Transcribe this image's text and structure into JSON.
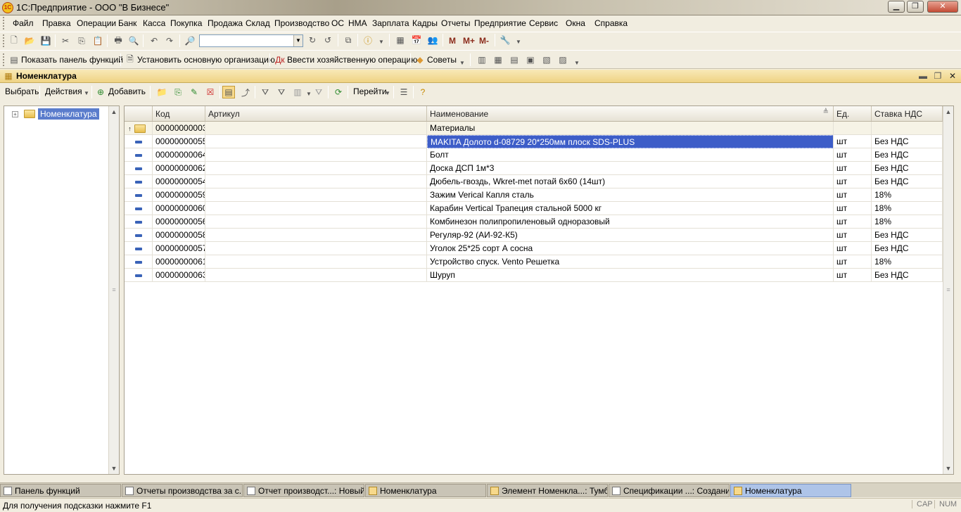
{
  "window": {
    "title": "1С:Предприятие - ООО \"В Бизнесе\"",
    "logo": "1С"
  },
  "menu": [
    "Файл",
    "Правка",
    "Операции",
    "Банк",
    "Касса",
    "Покупка",
    "Продажа",
    "Склад",
    "Производство",
    "ОС",
    "НМА",
    "Зарплата",
    "Кадры",
    "Отчеты",
    "Предприятие",
    "Сервис",
    "Окна",
    "Справка"
  ],
  "toolbar2": {
    "show_panel": "Показать панель функций",
    "set_org": "Установить основную организацию",
    "enter_op": "Ввести хозяйственную операцию",
    "tips": "Советы"
  },
  "toolbar1": {
    "m": "M",
    "mplus": "M+",
    "mminus": "M-"
  },
  "document": {
    "title": "Номенклатура"
  },
  "formbar": {
    "select": "Выбрать",
    "actions": "Действия",
    "add": "Добавить",
    "goto": "Перейти"
  },
  "tree": {
    "root": "Номенклатура"
  },
  "columns": {
    "code": "Код",
    "article": "Артикул",
    "name": "Наименование",
    "unit": "Ед.",
    "vat": "Ставка НДС"
  },
  "group_row": {
    "code": "00000000003",
    "name": "Материалы"
  },
  "rows": [
    {
      "code": "00000000055",
      "name": "MAKITA Долото d-08729 20*250мм плоск SDS-PLUS",
      "unit": "шт",
      "vat": "Без НДС"
    },
    {
      "code": "00000000064",
      "name": "Болт",
      "unit": "шт",
      "vat": "Без НДС"
    },
    {
      "code": "00000000062",
      "name": "Доска ДСП 1м*3",
      "unit": "шт",
      "vat": "Без НДС"
    },
    {
      "code": "00000000054",
      "name": "Дюбель-гвоздь, Wkret-met потай 6х60 (14шт)",
      "unit": "шт",
      "vat": "Без НДС"
    },
    {
      "code": "00000000059",
      "name": "Зажим Verical Капля сталь",
      "unit": "шт",
      "vat": "18%"
    },
    {
      "code": "00000000060",
      "name": "Карабин Vertical Трапеция стальной 5000 кг",
      "unit": "шт",
      "vat": "18%"
    },
    {
      "code": "00000000056",
      "name": "Комбинезон полипропиленовый одноразовый",
      "unit": "шт",
      "vat": "18%"
    },
    {
      "code": "00000000058",
      "name": "Регуляр-92 (АИ-92-К5)",
      "unit": "шт",
      "vat": "Без НДС"
    },
    {
      "code": "00000000057",
      "name": "Уголок 25*25 сорт А сосна",
      "unit": "шт",
      "vat": "Без НДС"
    },
    {
      "code": "00000000061",
      "name": "Устройство спуск. Vento Решетка",
      "unit": "шт",
      "vat": "18%"
    },
    {
      "code": "00000000063",
      "name": "Шуруп",
      "unit": "шт",
      "vat": "Без НДС"
    }
  ],
  "taskbar": [
    "Панель функций",
    "Отчеты производства за с...",
    "Отчет производст...: Новый *",
    "Номенклатура",
    "Элемент Номенкла...: Тумба",
    "Спецификации ...: Создание *",
    "Номенклатура"
  ],
  "status": {
    "hint": "Для получения подсказки нажмите F1",
    "cap": "CAP",
    "num": "NUM"
  }
}
